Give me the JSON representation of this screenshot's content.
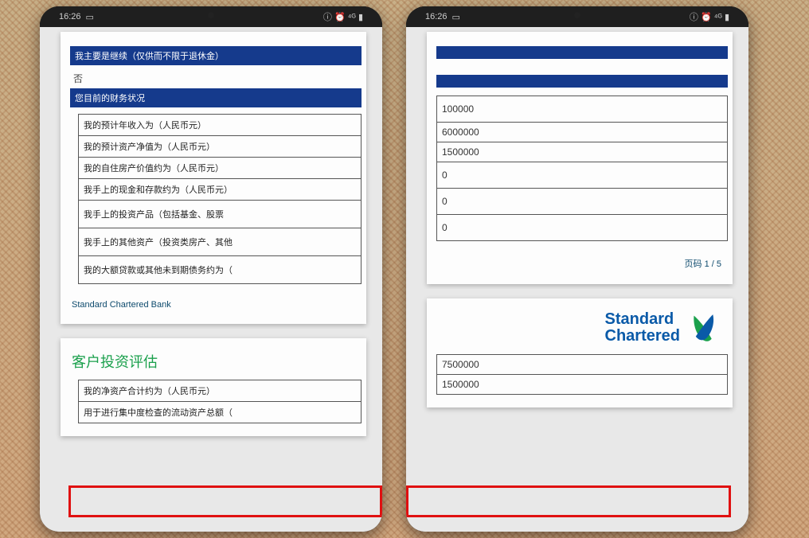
{
  "status": {
    "time": "16:26",
    "icons_right": "ⓘ ⏰ ⁴ᴳ ▮"
  },
  "left": {
    "top_muted": " ",
    "blue1": "我主要是继续（仅供而不限于退休金）",
    "char_trail": "否",
    "blue2": "您目前的财务状况",
    "labels": [
      "我的预计年收入为（人民币元）",
      "我的预计资产净值为（人民币元）",
      "我的自住房产价值约为（人民币元）",
      "我手上的现金和存款约为（人民币元）",
      "我手上的投资产品（包括基金、股票",
      "我手上的其他资产（投资类房产、其他",
      "我的大额贷款或其他未到期债务约为（"
    ],
    "footer": "Standard Chartered Bank",
    "section_title": "客户投资评估",
    "bottom_labels": [
      "我的净资产合计约为（人民币元）",
      "用于进行集中度检查的流动资产总额（"
    ]
  },
  "right": {
    "values": [
      "100000",
      "6000000",
      "1500000",
      "0",
      "0",
      "0"
    ],
    "footer_page": "页码 1 / 5",
    "brand_line1": "Standard",
    "brand_line2": "Chartered",
    "bottom_values": [
      "7500000",
      "1500000"
    ]
  }
}
